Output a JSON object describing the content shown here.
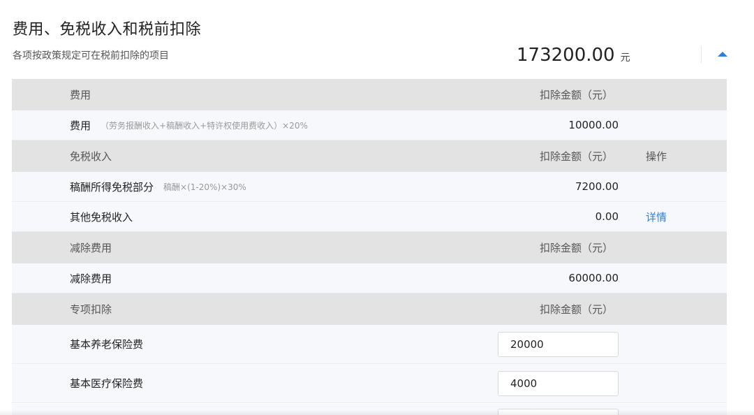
{
  "section": {
    "title": "费用、免税收入和税前扣除",
    "subtitle": "各项按政策规定可在税前扣除的项目",
    "total_amount": "173200.00",
    "total_unit": "元"
  },
  "groups": {
    "expense": {
      "header_label": "费用",
      "amount_header": "扣除金额（元）",
      "rows": [
        {
          "label": "费用",
          "formula": "（劳务报酬收入+稿酬收入+特许权使用费收入）×20%",
          "amount": "10000.00"
        }
      ]
    },
    "tax_free": {
      "header_label": "免税收入",
      "amount_header": "扣除金额（元）",
      "op_header": "操作",
      "rows": [
        {
          "label": "稿酬所得免税部分",
          "formula": "稿酬×(1-20%)×30%",
          "amount": "7200.00"
        },
        {
          "label": "其他免税收入",
          "amount": "0.00",
          "op": "详情"
        }
      ]
    },
    "deduction": {
      "header_label": "减除费用",
      "amount_header": "扣除金额（元）",
      "rows": [
        {
          "label": "减除费用",
          "amount": "60000.00"
        }
      ]
    },
    "special": {
      "header_label": "专项扣除",
      "amount_header": "扣除金额（元）",
      "rows": [
        {
          "label": "基本养老保险费",
          "value": "20000"
        },
        {
          "label": "基本医疗保险费",
          "value": "4000"
        }
      ]
    }
  },
  "colors": {
    "accent": "#2f7fd8",
    "header_bg": "#e3e3e3",
    "row_bg": "#f7f8fc"
  },
  "icons": {
    "collapse": "caret-up-icon"
  }
}
